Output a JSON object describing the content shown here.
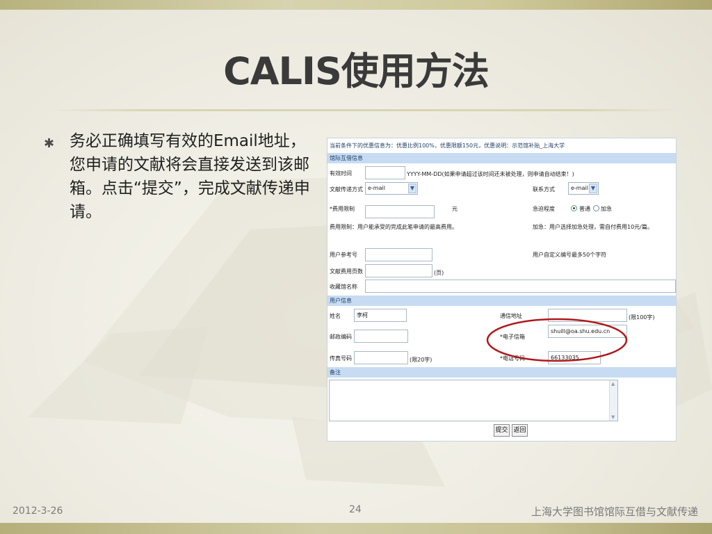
{
  "slide": {
    "title": "CALIS使用方法",
    "bullet_symbol": "✱",
    "bullet_text": "务必正确填写有效的Email地址，您申请的文献将会直接发送到该邮箱。点击“提交”，完成文献传递申请。",
    "footer": {
      "date": "2012-3-26",
      "page": "24",
      "org": "上海大学图书馆馆际互借与文献传递"
    }
  },
  "form": {
    "notice": "当前条件下的优惠信息为：优惠比例100%，优惠限额150元，优惠说明：示范馆补贴_上海大学",
    "ill_section": "馆际互借信息",
    "valid_time_label": "有效时间",
    "valid_time_hint": "YYYY-MM-DD(如果申请超过该时间还未被处理，则申请自动结束！)",
    "delivery_label": "文献传递方式",
    "delivery_value": "e-mail",
    "contact_label": "联系方式",
    "contact_value": "e-mail",
    "fee_limit_label": "*费用限制",
    "fee_unit": "元",
    "urgency_label": "急迫程度",
    "urgency_normal": "普通",
    "urgency_urgent": "加急",
    "fee_note": "费用限制：用户能承受的完成此笔申请的最高费用。",
    "urgent_note": "加急：用户选择加急处理，需自付费用10元/篇。",
    "ref_no_label": "用户参考号",
    "ref_no_note": "用户自定义编号最多50个字符",
    "pages_label": "文献费用页数",
    "pages_unit": "(页)",
    "holding_label": "收藏馆名称",
    "user_section": "用户信息",
    "name_label": "姓名",
    "name_value": "李柯",
    "address_label": "通信地址",
    "address_limit": "(限100字)",
    "postcode_label": "邮政编码",
    "email_label": "*电子信箱",
    "email_value": "shuill@oa.shu.edu.cn",
    "fax_label": "传真号码",
    "fax_limit": "(限20字)",
    "phone_label": "*电话号码",
    "phone_value": "66133035",
    "remark_section": "备注",
    "submit_label": "提交",
    "back_label": "返回"
  },
  "colors": {
    "section_bar": "#c7dcf3",
    "highlight_ellipse": "#b0171a",
    "title": "#3a3a3a"
  }
}
